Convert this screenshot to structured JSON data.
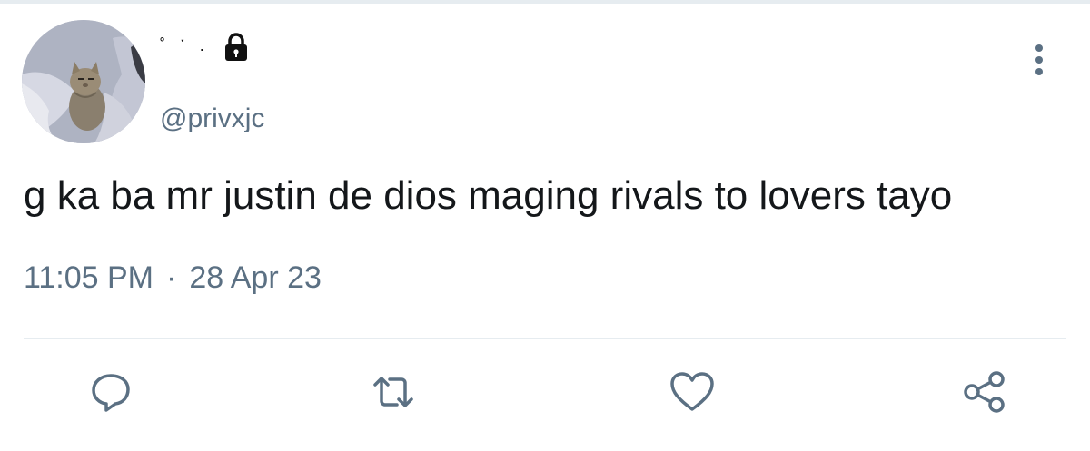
{
  "user": {
    "display_name": "˚ ་ .",
    "handle": "@privxjc",
    "avatar_icon": "cat-photo",
    "protected_icon": "lock-icon"
  },
  "tweet": {
    "text": "g ka ba mr justin de dios maging rivals to lovers tayo",
    "time": "11:05 PM",
    "separator": "·",
    "date": "28 Apr 23"
  },
  "actions": {
    "more_icon": "more-vertical-icon",
    "reply_icon": "reply-icon",
    "retweet_icon": "retweet-icon",
    "like_icon": "heart-icon",
    "share_icon": "share-icon"
  },
  "colors": {
    "text_primary": "#14171a",
    "text_secondary": "#5b7083",
    "divider": "#e6ecf0"
  }
}
